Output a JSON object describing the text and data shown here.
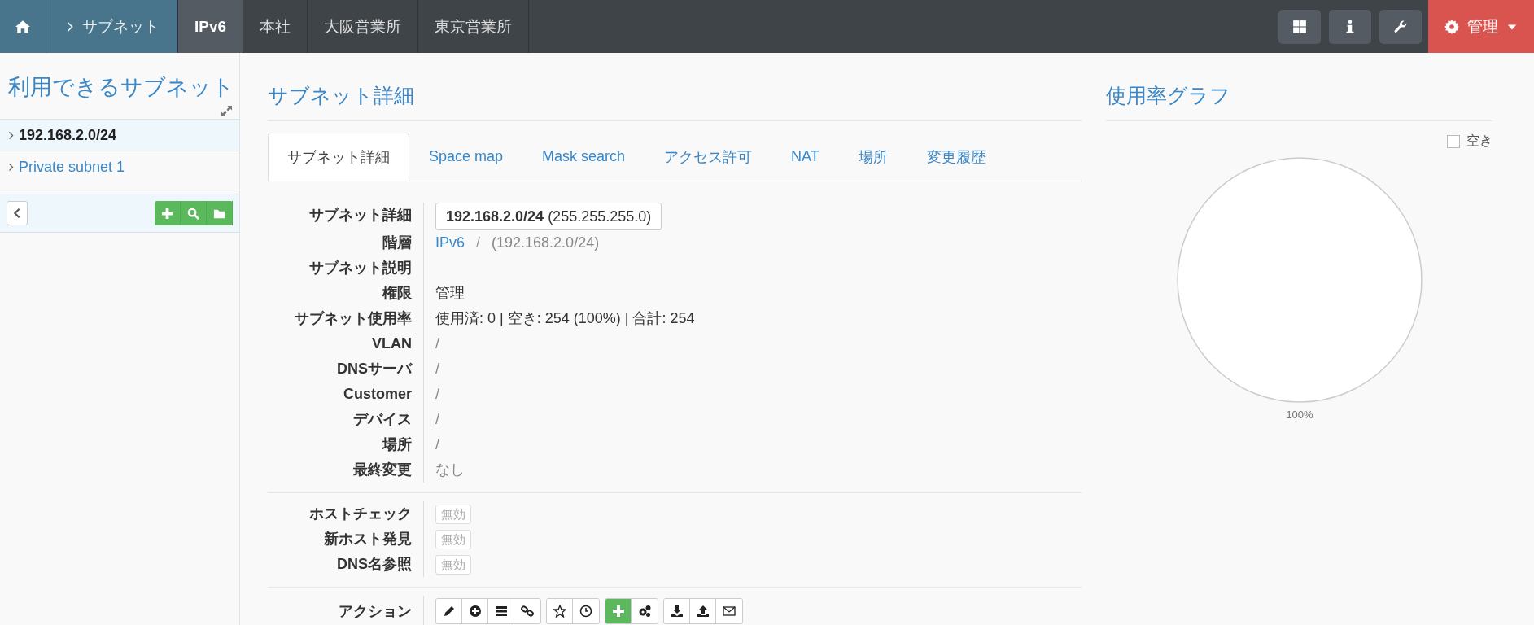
{
  "navbar": {
    "home": {
      "kind": "home"
    },
    "items": [
      {
        "label": "サブネット",
        "kind": "section",
        "selected": false
      },
      {
        "label": "IPv6",
        "kind": "tab",
        "selected": true
      },
      {
        "label": "本社",
        "kind": "tab",
        "selected": false
      },
      {
        "label": "大阪営業所",
        "kind": "tab",
        "selected": false
      },
      {
        "label": "東京営業所",
        "kind": "tab",
        "selected": false
      }
    ],
    "tools": [
      {
        "kind": "grid"
      },
      {
        "kind": "info"
      },
      {
        "kind": "wrench"
      }
    ],
    "admin": {
      "label": "管理"
    }
  },
  "sidebar": {
    "title": "利用できるサブネット",
    "items": [
      {
        "label": "192.168.2.0/24",
        "selected": true
      },
      {
        "label": "Private subnet 1",
        "selected": false
      }
    ],
    "tools": [
      {
        "kind": "plus"
      },
      {
        "kind": "search"
      },
      {
        "kind": "folder"
      }
    ]
  },
  "main": {
    "heading": "サブネット詳細",
    "tabs": [
      {
        "label": "サブネット詳細",
        "selected": true
      },
      {
        "label": "Space map",
        "selected": false
      },
      {
        "label": "Mask search",
        "selected": false
      },
      {
        "label": "アクセス許可",
        "selected": false
      },
      {
        "label": "NAT",
        "selected": false
      },
      {
        "label": "場所",
        "selected": false
      },
      {
        "label": "変更履歴",
        "selected": false
      }
    ],
    "details": [
      {
        "label": "サブネット詳細",
        "kind": "subnet",
        "value": "**192.168.2.0/24** (255.255.255.0)"
      },
      {
        "label": "階層",
        "kind": "path",
        "link": "IPv6",
        "separator": "/",
        "value": "(192.168.2.0/24)"
      },
      {
        "label": "サブネット説明",
        "kind": "text"
      },
      {
        "label": "権限",
        "kind": "text",
        "value": "管理"
      },
      {
        "label": "サブネット使用率",
        "kind": "text",
        "value": "使用済: 0 | 空き: 254 (100%) | 合計: 254"
      },
      {
        "label": "VLAN",
        "kind": "muted",
        "value": "/"
      },
      {
        "label": "DNSサーバ",
        "kind": "muted",
        "value": "/"
      },
      {
        "label": "Customer",
        "kind": "muted",
        "value": "/"
      },
      {
        "label": "デバイス",
        "kind": "muted",
        "value": "/"
      },
      {
        "label": "場所",
        "kind": "muted",
        "value": "/"
      },
      {
        "label": "最終変更",
        "kind": "muted",
        "value": "なし"
      }
    ],
    "scans": [
      {
        "label": "ホストチェック",
        "badge": "無効",
        "enabled": false
      },
      {
        "label": "新ホスト発見",
        "badge": "無効",
        "enabled": false
      },
      {
        "label": "DNS名参照",
        "badge": "無効",
        "enabled": false
      }
    ],
    "actions": {
      "label": "アクション",
      "groups": [
        [
          {
            "kind": "edit",
            "highlighted": false
          },
          {
            "kind": "plus-circle",
            "highlighted": false
          },
          {
            "kind": "list",
            "highlighted": false
          },
          {
            "kind": "link",
            "highlighted": false
          }
        ],
        [
          {
            "kind": "star",
            "highlighted": false
          },
          {
            "kind": "clock",
            "highlighted": false
          }
        ],
        [
          {
            "kind": "plus",
            "highlighted": true
          },
          {
            "kind": "gears",
            "highlighted": false
          }
        ],
        [
          {
            "kind": "download",
            "highlighted": false
          },
          {
            "kind": "upload",
            "highlighted": false
          },
          {
            "kind": "envelope",
            "highlighted": false
          }
        ]
      ]
    }
  },
  "usage": {
    "heading": "使用率グラフ",
    "chart_data": {
      "type": "pie",
      "series": [
        {
          "name": "空き",
          "color": "#ffffff",
          "values": [
            100
          ]
        }
      ],
      "value_labels": [
        "100%"
      ]
    }
  }
}
